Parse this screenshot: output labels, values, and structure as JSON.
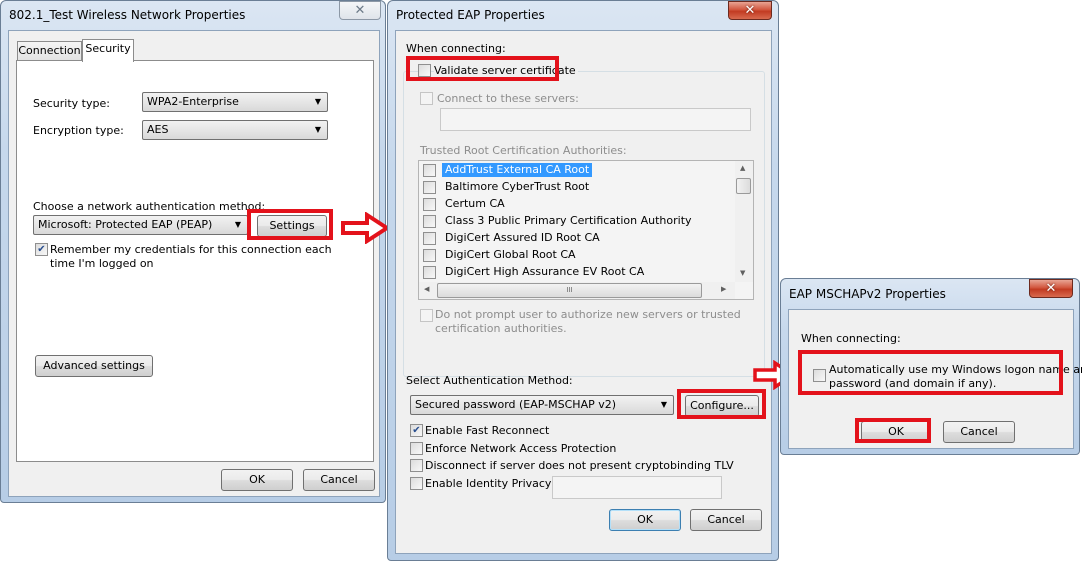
{
  "win1": {
    "title": "802.1_Test Wireless Network Properties",
    "close_glyph": "✕",
    "tabs": [
      {
        "label": "Connection",
        "active": false
      },
      {
        "label": "Security",
        "active": true
      }
    ],
    "security_type_label": "Security type:",
    "security_type_value": "WPA2-Enterprise",
    "encryption_type_label": "Encryption type:",
    "encryption_type_value": "AES",
    "auth_method_label": "Choose a network authentication method:",
    "auth_method_value": "Microsoft: Protected EAP (PEAP)",
    "settings_button": "Settings",
    "remember_credentials_label_line1": "Remember my credentials for this connection each",
    "remember_credentials_label_line2": "time I'm logged on",
    "remember_credentials_checked": true,
    "advanced_settings_button": "Advanced settings",
    "ok_button": "OK",
    "cancel_button": "Cancel"
  },
  "win2": {
    "title": "Protected EAP Properties",
    "close_glyph": "✕",
    "when_connecting_label": "When connecting:",
    "validate_cert_label": "Validate server certificate",
    "validate_cert_checked": false,
    "connect_servers_label": "Connect to these servers:",
    "connect_servers_value": "",
    "trusted_root_label": "Trusted Root Certification Authorities:",
    "cert_authorities": [
      {
        "name": "AddTrust External CA Root",
        "checked": false,
        "selected": true
      },
      {
        "name": "Baltimore CyberTrust Root",
        "checked": false,
        "selected": false
      },
      {
        "name": "Certum CA",
        "checked": false,
        "selected": false
      },
      {
        "name": "Class 3 Public Primary Certification Authority",
        "checked": false,
        "selected": false
      },
      {
        "name": "DigiCert Assured ID Root CA",
        "checked": false,
        "selected": false
      },
      {
        "name": "DigiCert Global Root CA",
        "checked": false,
        "selected": false
      },
      {
        "name": "DigiCert High Assurance EV Root CA",
        "checked": false,
        "selected": false
      }
    ],
    "hscroll_grip": "III",
    "do_not_prompt_line1": "Do not prompt user to authorize new servers or trusted",
    "do_not_prompt_line2": "certification authorities.",
    "select_auth_label": "Select Authentication Method:",
    "auth_method_value": "Secured password (EAP-MSCHAP v2)",
    "configure_button": "Configure...",
    "options": [
      {
        "label": "Enable Fast Reconnect",
        "checked": true
      },
      {
        "label": "Enforce Network Access Protection",
        "checked": false
      },
      {
        "label": "Disconnect if server does not present cryptobinding TLV",
        "checked": false
      },
      {
        "label": "Enable Identity Privacy",
        "checked": false
      }
    ],
    "identity_privacy_value": "",
    "ok_button": "OK",
    "cancel_button": "Cancel"
  },
  "win3": {
    "title": "EAP MSCHAPv2 Properties",
    "close_glyph": "✕",
    "when_connecting_label": "When connecting:",
    "auto_logon_line1": "Automatically use my Windows logon name and",
    "auto_logon_line2": "password (and domain if any).",
    "auto_logon_checked": false,
    "ok_button": "OK",
    "cancel_button": "Cancel"
  },
  "glyphs": {
    "check": "✔",
    "dropdown": "▼",
    "scroll_up": "▲",
    "scroll_down": "▼",
    "scroll_left": "◀",
    "scroll_right": "▶"
  },
  "colors": {
    "highlight_red": "#e3121b",
    "selection_blue": "#3399ff"
  }
}
